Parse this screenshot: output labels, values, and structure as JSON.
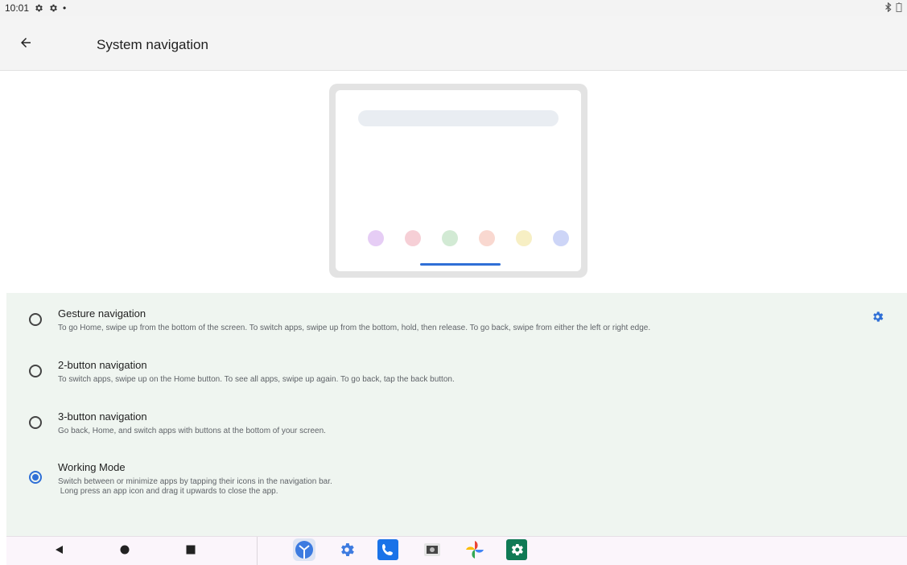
{
  "status_bar": {
    "time": "10:01",
    "icons": [
      "gear-icon",
      "gear-icon",
      "dot-icon",
      "bluetooth-icon",
      "battery-icon"
    ]
  },
  "app_bar": {
    "title": "System navigation",
    "back_icon": "arrow-left-icon"
  },
  "illustration": {
    "dot_colors": [
      "#e6cdf5",
      "#f6cfd6",
      "#d2ead4",
      "#f9d8d0",
      "#f7efc4",
      "#cdd5f7"
    ],
    "handle_color": "#2f6fd6"
  },
  "options": [
    {
      "title": "Gesture navigation",
      "description": "To go Home, swipe up from the bottom of the screen. To switch apps, swipe up from the bottom, hold, then release. To go back, swipe from either the left or right edge.",
      "selected": false,
      "has_settings": true
    },
    {
      "title": "2-button navigation",
      "description": "To switch apps, swipe up on the Home button. To see all apps, swipe up again. To go back, tap the back button.",
      "selected": false
    },
    {
      "title": "3-button navigation",
      "description": "Go back, Home, and switch apps with buttons at the bottom of your screen.",
      "selected": false
    },
    {
      "title": "Working Mode",
      "description": "Switch between or minimize apps by tapping their icons in the navigation bar.\n Long press an app icon and drag it upwards to close the app.",
      "selected": true
    }
  ],
  "nav_bar": {
    "keys": [
      "back-triangle-icon",
      "home-circle-icon",
      "recents-square-icon"
    ],
    "dock_apps": [
      "clock-app-icon",
      "settings-app-icon",
      "phone-app-icon",
      "camera-app-icon",
      "photos-app-icon",
      "settings-green-app-icon"
    ]
  },
  "colors": {
    "accent": "#2f6fd6",
    "panel_bg": "#eff5f0"
  }
}
